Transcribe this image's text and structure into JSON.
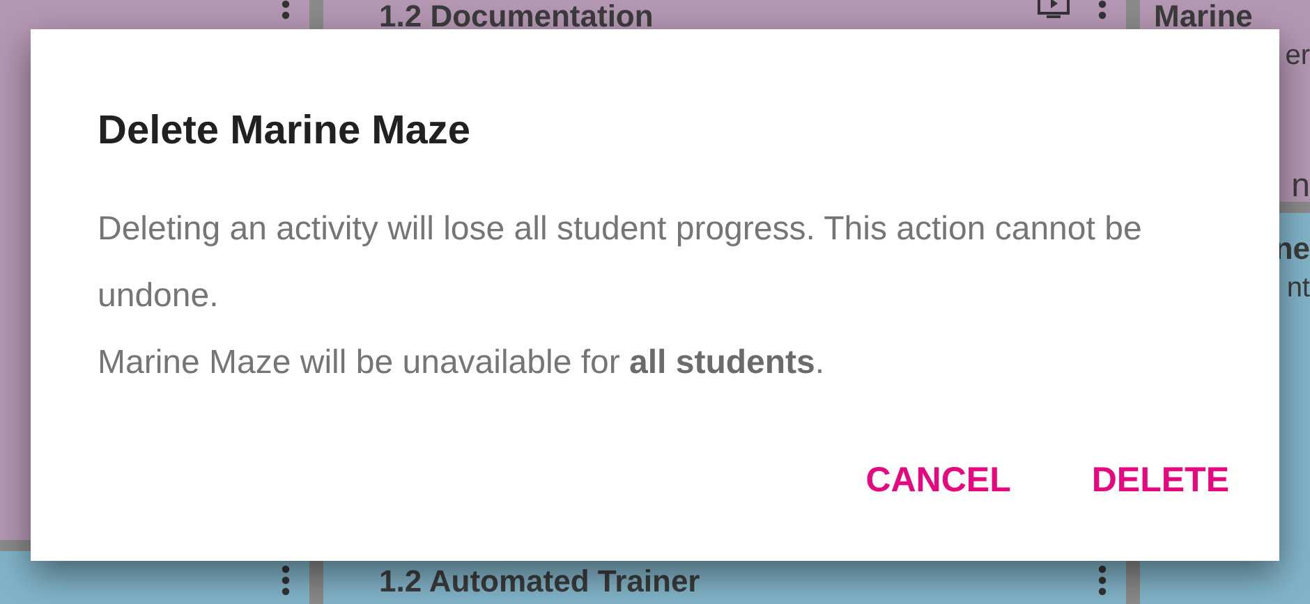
{
  "background": {
    "columns": [
      {
        "cards": [
          {
            "color": "#b497b3",
            "icons": [
              {
                "kind": "menu"
              }
            ]
          },
          {
            "color": "#82b4c9",
            "icons": [
              {
                "kind": "menu"
              }
            ]
          }
        ]
      },
      {
        "cards": [
          {
            "color": "#b497b3",
            "title": "1.2 Documentation",
            "icons": [
              {
                "kind": "video"
              },
              {
                "kind": "menu"
              }
            ]
          },
          {
            "color": "#82b4c9",
            "title": "1.2 Automated Trainer",
            "icons": [
              {
                "kind": "menu"
              }
            ]
          }
        ]
      },
      {
        "cards": [
          {
            "color": "#b497b3",
            "title": "Marine",
            "lines": [
              "er",
              "n"
            ]
          },
          {
            "color": "#82b4c9",
            "title": "ne",
            "lines": [
              "nt"
            ]
          }
        ]
      }
    ]
  },
  "dialog": {
    "title": "Delete Marine Maze",
    "paragraphs": [
      "Deleting an activity will lose all student progress. This action cannot be undone.",
      "Marine Maze will be unavailable for **all students**."
    ],
    "buttons": [
      "CANCEL",
      "DELETE"
    ]
  }
}
